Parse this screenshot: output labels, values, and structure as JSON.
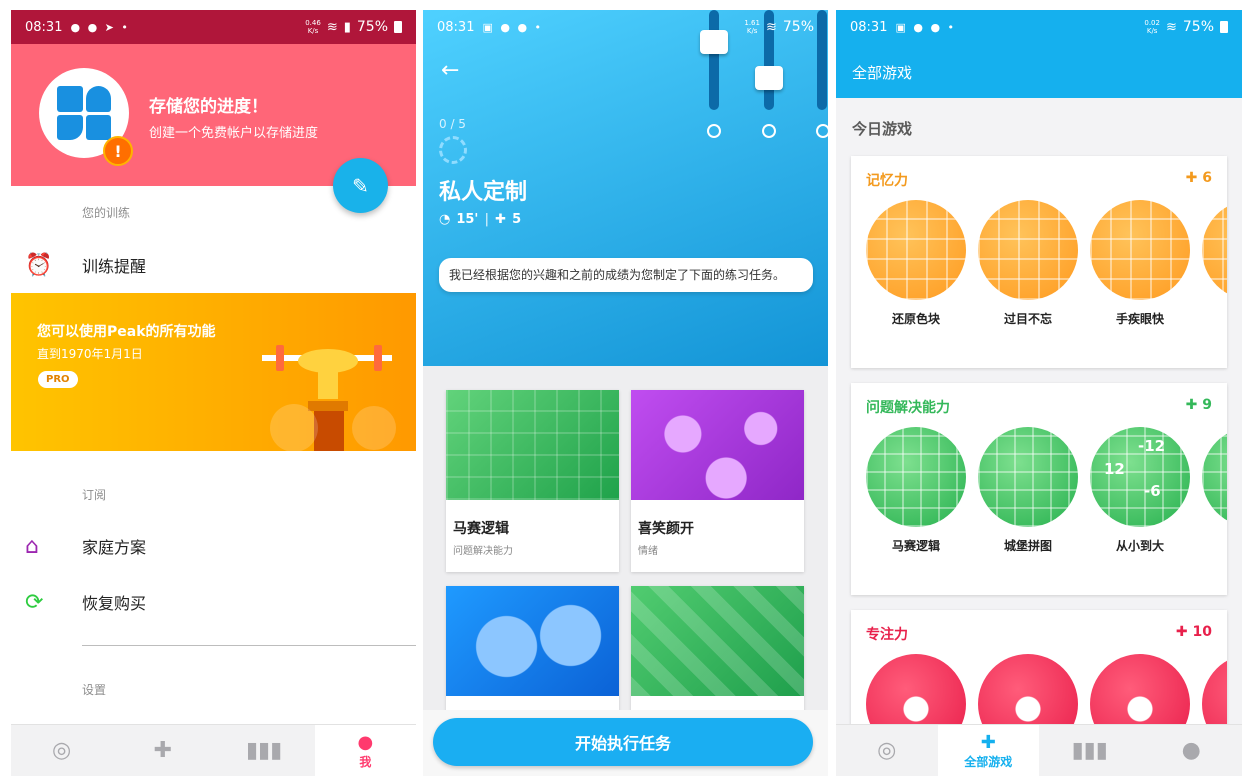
{
  "screen1": {
    "status": {
      "time": "08:31",
      "speed_top": "0.46",
      "speed_bottom": "K/s",
      "battery": "75%"
    },
    "hero": {
      "title": "存储您的进度！",
      "subtitle": "创建一个免费帐户以存储进度"
    },
    "sections": {
      "training": "您的训练",
      "subscription": "订阅",
      "settings": "设置"
    },
    "menu": {
      "reminder": "训练提醒",
      "family": "家庭方案",
      "restore": "恢复购买"
    },
    "promo": {
      "title": "您可以使用Peak的所有功能",
      "subtitle": "直到1970年1月1日",
      "badge": "PRO"
    },
    "tabs": {
      "me": "我"
    },
    "colors": {
      "hero": "#ff6678",
      "accent": "#19b2ea",
      "promo": "#ffb300"
    }
  },
  "screen2": {
    "status": {
      "time": "08:31",
      "speed_top": "1.61",
      "speed_bottom": "K/s",
      "battery": "75%"
    },
    "progress": "0 / 5",
    "title": "私人定制",
    "duration": "15'",
    "games_count": "5",
    "message": "我已经根据您的兴趣和之前的成绩为您制定了下面的练习任务。",
    "cards": [
      {
        "title": "马赛逻辑",
        "subtitle": "问题解决能力"
      },
      {
        "title": "喜笑颜开",
        "subtitle": "情绪"
      }
    ],
    "start_button": "开始执行任务"
  },
  "screen3": {
    "status": {
      "time": "08:31",
      "speed_top": "0.02",
      "speed_bottom": "K/s",
      "battery": "75%"
    },
    "appbar_title": "全部游戏",
    "today_label": "今日游戏",
    "categories": [
      {
        "name": "记忆力",
        "count": "6",
        "color": "#f39a1e",
        "games": [
          "还原色块",
          "过目不忘",
          "手疾眼快"
        ]
      },
      {
        "name": "问题解决能力",
        "count": "9",
        "color": "#34b85a",
        "games": [
          "马赛逻辑",
          "城堡拼图",
          "从小到大"
        ]
      },
      {
        "name": "专注力",
        "count": "10",
        "color": "#e8204b",
        "games": []
      }
    ],
    "numbers": [
      "-12",
      "12",
      "-6"
    ],
    "tabs": {
      "all_games": "全部游戏"
    }
  }
}
